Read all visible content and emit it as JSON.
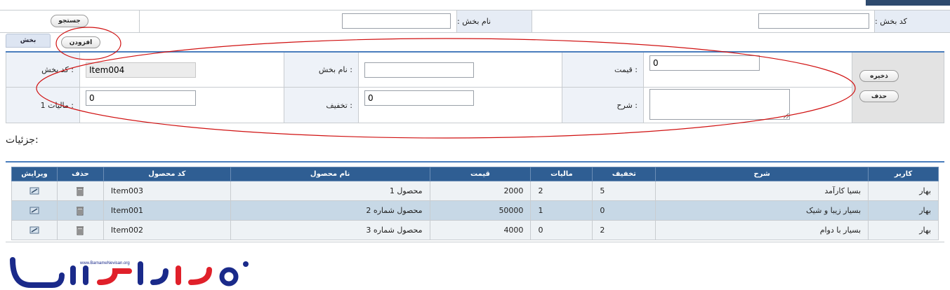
{
  "search": {
    "code_label": "کد بخش :",
    "name_label": "نام بخش :",
    "search_button": "جستجو",
    "code_value": "",
    "name_value": ""
  },
  "tab": {
    "label": "بخش"
  },
  "add_button": "افزودن",
  "form": {
    "code_label": ": کد بخش",
    "code_value": "Item004",
    "name_label": ": نام بخش",
    "name_value": "",
    "price_label": ": قیمت",
    "price_value": "0",
    "tax_label": ": مالیات 1",
    "tax_value": "0",
    "discount_label": ": تخفیف",
    "discount_value": "0",
    "desc_label": ": شرح",
    "desc_value": "",
    "save_button": "ذخیره",
    "delete_button": "حذف"
  },
  "details_title": ":جزئیات",
  "grid": {
    "headers": {
      "edit": "ویرایش",
      "delete": "حذف",
      "code": "کد محصول",
      "name": "نام محصول",
      "price": "قیمت",
      "tax": "مالیات",
      "discount": "تخفیف",
      "desc": "شرح",
      "user": "کاربر"
    },
    "rows": [
      {
        "code": "Item003",
        "name": "محصول 1",
        "price": "2000",
        "tax": "2",
        "discount": "5",
        "desc": "بسیا کارآمد",
        "user": "بهار"
      },
      {
        "code": "Item001",
        "name": "محصول شماره 2",
        "price": "50000",
        "tax": "1",
        "discount": "0",
        "desc": "بسیار زیبا و شیک",
        "user": "بهار"
      },
      {
        "code": "Item002",
        "name": "محصول شماره 3",
        "price": "4000",
        "tax": "0",
        "discount": "2",
        "desc": "بسیار با دوام",
        "user": "بهار"
      }
    ]
  },
  "logo": {
    "text": "برنامه نویسان",
    "url_text": "www.BarnameNevisan.org"
  },
  "icons": {
    "edit": "edit-icon",
    "delete": "trash-icon"
  },
  "colors": {
    "header_blue": "#2f5e93",
    "accent_line": "#4a7dbd",
    "label_bg": "#e6ecf5",
    "alt_row": "#c7d8e6",
    "annotation_red": "#d01010",
    "logo_blue": "#1a2a8a",
    "logo_red": "#e0202a"
  }
}
